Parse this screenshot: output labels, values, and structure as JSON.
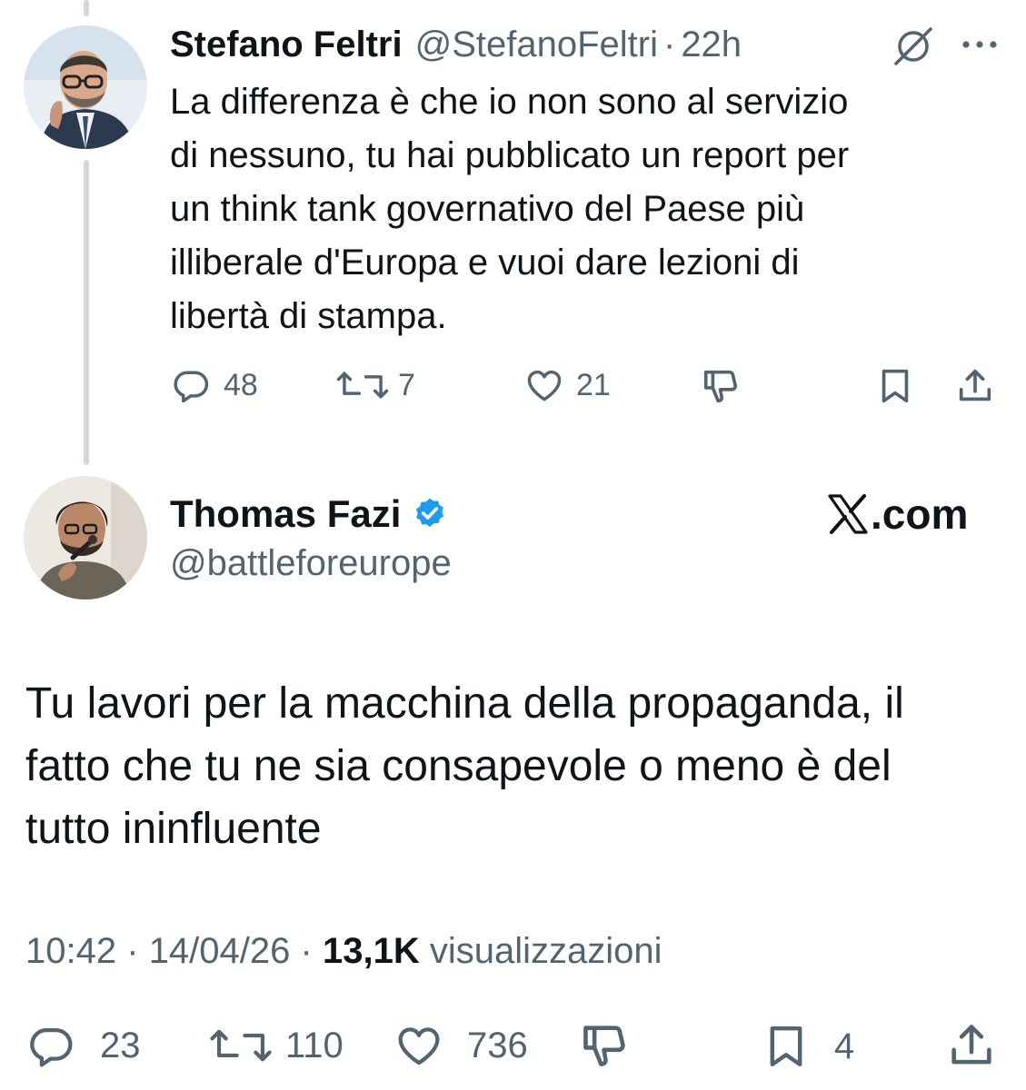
{
  "parent_tweet": {
    "display_name": "Stefano Feltri",
    "handle": "@StefanoFeltri",
    "separator": "·",
    "time_ago": "22h",
    "text": "La differenza è che io non sono al servizio\ndi nessuno, tu hai pubblicato un report per\nun think tank governativo del Paese più\nilliberale d'Europa e vuoi dare lezioni di\nlibertà di stampa.",
    "actions": {
      "replies": "48",
      "reposts": "7",
      "likes": "21"
    },
    "icons": [
      "grok-icon",
      "more-icon",
      "reply-icon",
      "repost-icon",
      "like-icon",
      "dislike-icon",
      "bookmark-icon",
      "share-icon"
    ]
  },
  "main_tweet": {
    "display_name": "Thomas Fazi",
    "handle": "@battleforeurope",
    "verified": true,
    "site_mark": ".com",
    "text": "Tu lavori per la macchina della propaganda, il\nfatto che tu ne sia consapevole o meno è del\ntutto ininfluente",
    "meta": {
      "time": "10:42",
      "separator": "·",
      "date": "14/04/26",
      "views_count": "13,1K",
      "views_label": "visualizzazioni"
    },
    "actions": {
      "replies": "23",
      "reposts": "110",
      "likes": "736",
      "bookmarks": "4"
    }
  },
  "colors": {
    "text": "#0f1419",
    "muted": "#536471",
    "verified_blue": "#1d9bf0",
    "thread_line": "#cfd9de"
  }
}
